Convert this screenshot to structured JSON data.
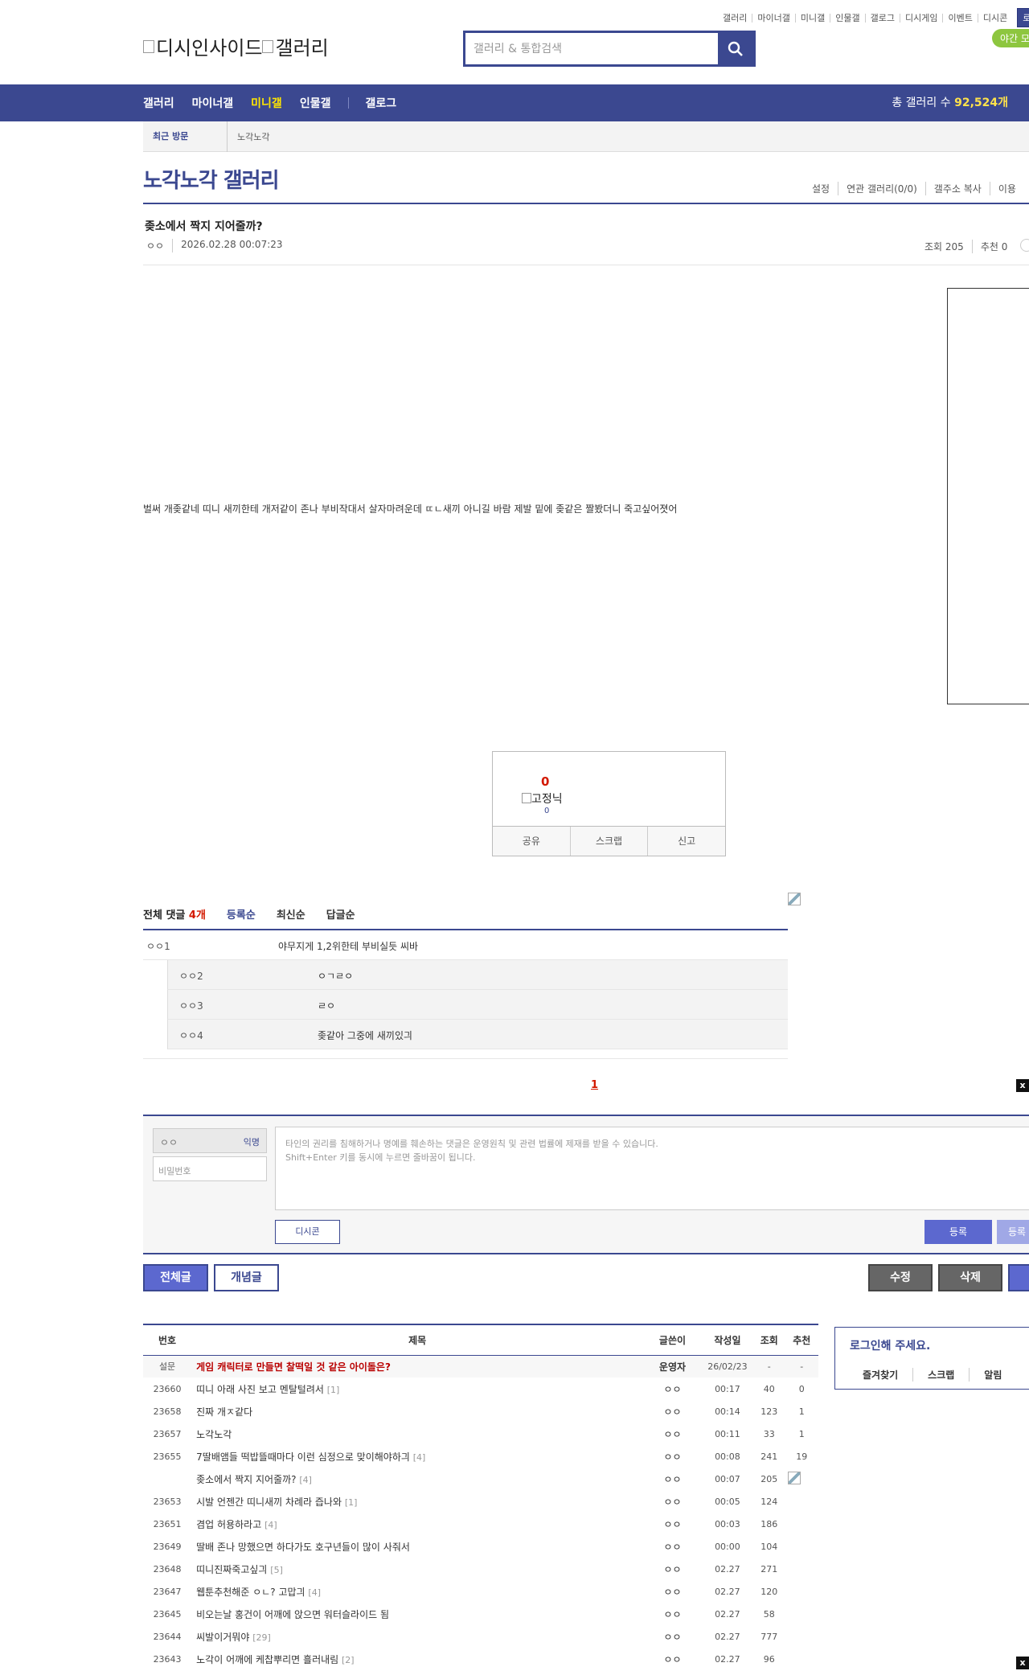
{
  "util_links": [
    "갤러리",
    "마이너갤",
    "미니갤",
    "인물갤",
    "갤로그",
    "디시게임",
    "이벤트",
    "디시콘"
  ],
  "login_label": "로그인",
  "night_mode": "야간 모",
  "logo": {
    "text1": "디시인사이드",
    "text2": "갤러리"
  },
  "search": {
    "placeholder": "갤러리 & 통합검색"
  },
  "gnb": {
    "items": [
      "갤러리",
      "마이너갤",
      "미니갤",
      "인물갤",
      "갤로그"
    ],
    "active": "미니갤",
    "total_label": "총 갤러리 수",
    "total_value": "92,524개"
  },
  "recent": {
    "label": "최근 방문",
    "item": "노각노각"
  },
  "gallery": {
    "title": "노각노각 갤러리",
    "tabs": [
      "설정",
      "연관 갤러리(0/0)",
      "갤주소 복사",
      "이용"
    ]
  },
  "post": {
    "title": "좆소에서 짝지 지어줄까?",
    "writer": "ㅇㅇ",
    "date": "2026.02.28 00:07:23",
    "views": "조회 205",
    "recommend": "추천 0",
    "body": "벌써 개좆같네 띠니 새끼한테 개저같이 존나 부비작대서 살자마려운데 ㄸㄴ새끼 아니길 바람 제발 밑에 좆같은 짤봤더니 죽고싶어졋어"
  },
  "recommend_box": {
    "up": "0",
    "fix_nick": "고정닉",
    "fix_count": "0",
    "actions": [
      "공유",
      "스크랩",
      "신고"
    ]
  },
  "comments": {
    "total_label": "전체 댓글",
    "total_count": "4개",
    "sorts": [
      "등록순",
      "최신순",
      "답글순"
    ],
    "items": [
      {
        "nick": "ㅇㅇ1",
        "text": "야무지게 1,2위한테 부비실듯 씨바",
        "reply": false
      },
      {
        "nick": "ㅇㅇ2",
        "text": "ㅇㄱㄹㅇ",
        "reply": true
      },
      {
        "nick": "ㅇㅇ3",
        "text": "ㄹㅇ",
        "reply": true
      },
      {
        "nick": "ㅇㅇ4",
        "text": "좆같아 그중에 새끼있긔",
        "reply": true
      }
    ],
    "page": "1"
  },
  "comment_write": {
    "nick": "ㅇㅇ",
    "anon": "익명",
    "password_placeholder": "비밀번호",
    "textarea_line1": "타인의 권리를 침해하거나 명예를 훼손하는 댓글은 운영원칙 및 관련 법률에 제재를 받을 수 있습니다.",
    "textarea_line2": "Shift+Enter 키를 동시에 누르면 줄바꿈이 됩니다.",
    "dccon": "디시콘",
    "submit": "등록",
    "submit2": "등록"
  },
  "board_buttons": {
    "all": "전체글",
    "best": "개념글",
    "edit": "수정",
    "delete": "삭제"
  },
  "list": {
    "headers": [
      "번호",
      "제목",
      "글쓴이",
      "작성일",
      "조회",
      "추천"
    ],
    "rows": [
      {
        "num": "설문",
        "title": "게임 캐릭터로 만들면 찰떡일 것 같은 아이돌은?",
        "cc": "",
        "writer": "운영자",
        "date": "26/02/23",
        "views": "-",
        "rec": "-",
        "notice": true
      },
      {
        "num": "23660",
        "title": "띠니 아래 사진 보고 멘탈털려서",
        "cc": "[1]",
        "writer": "ㅇㅇ",
        "date": "00:17",
        "views": "40",
        "rec": "0"
      },
      {
        "num": "23658",
        "title": "진짜 개ㅈ같다",
        "cc": "",
        "writer": "ㅇㅇ",
        "date": "00:14",
        "views": "123",
        "rec": "1"
      },
      {
        "num": "23657",
        "title": "노각노각",
        "cc": "",
        "writer": "ㅇㅇ",
        "date": "00:11",
        "views": "33",
        "rec": "1"
      },
      {
        "num": "23655",
        "title": "7딸배앰들 떡밥뜰때마다 이런 심정으로 맞이해야하긔",
        "cc": "[4]",
        "writer": "ㅇㅇ",
        "date": "00:08",
        "views": "241",
        "rec": "19"
      },
      {
        "num": "",
        "title": "좆소에서 짝지 지어줄까?",
        "cc": "[4]",
        "writer": "ㅇㅇ",
        "date": "00:07",
        "views": "205",
        "rec": ""
      },
      {
        "num": "23653",
        "title": "시발 언젠간 띠니새끼 차례라 즙나와",
        "cc": "[1]",
        "writer": "ㅇㅇ",
        "date": "00:05",
        "views": "124",
        "rec": ""
      },
      {
        "num": "23651",
        "title": "겸업 허용하라고",
        "cc": "[4]",
        "writer": "ㅇㅇ",
        "date": "00:03",
        "views": "186",
        "rec": ""
      },
      {
        "num": "23649",
        "title": "딸배 존나 망했으면 하다가도 호구년들이 많이 사줘서",
        "cc": "",
        "writer": "ㅇㅇ",
        "date": "00:00",
        "views": "104",
        "rec": ""
      },
      {
        "num": "23648",
        "title": "띠니진짜죽고싶긔",
        "cc": "[5]",
        "writer": "ㅇㅇ",
        "date": "02.27",
        "views": "271",
        "rec": ""
      },
      {
        "num": "23647",
        "title": "웹툰추천해준 ㅇㄴ? 고맙긔",
        "cc": "[4]",
        "writer": "ㅇㅇ",
        "date": "02.27",
        "views": "120",
        "rec": ""
      },
      {
        "num": "23645",
        "title": "비오는날 홍건이 어깨에 앉으면 워터슬라이드 됨",
        "cc": "",
        "writer": "ㅇㅇ",
        "date": "02.27",
        "views": "58",
        "rec": ""
      },
      {
        "num": "23644",
        "title": "씨발이거뭐야",
        "cc": "[29]",
        "writer": "ㅇㅇ",
        "date": "02.27",
        "views": "777",
        "rec": ""
      },
      {
        "num": "23643",
        "title": "노각이 어깨에 케찹뿌리면 흘러내림",
        "cc": "[2]",
        "writer": "ㅇㅇ",
        "date": "02.27",
        "views": "96",
        "rec": ""
      }
    ]
  },
  "login_box": {
    "message": "로그인해 주세요.",
    "links": [
      "즐겨찾기",
      "스크랩",
      "알림"
    ]
  },
  "colors": {
    "primary": "#3b4890",
    "accent": "#5c68cf",
    "red": "#d31900",
    "yellow": "#ffe600"
  }
}
